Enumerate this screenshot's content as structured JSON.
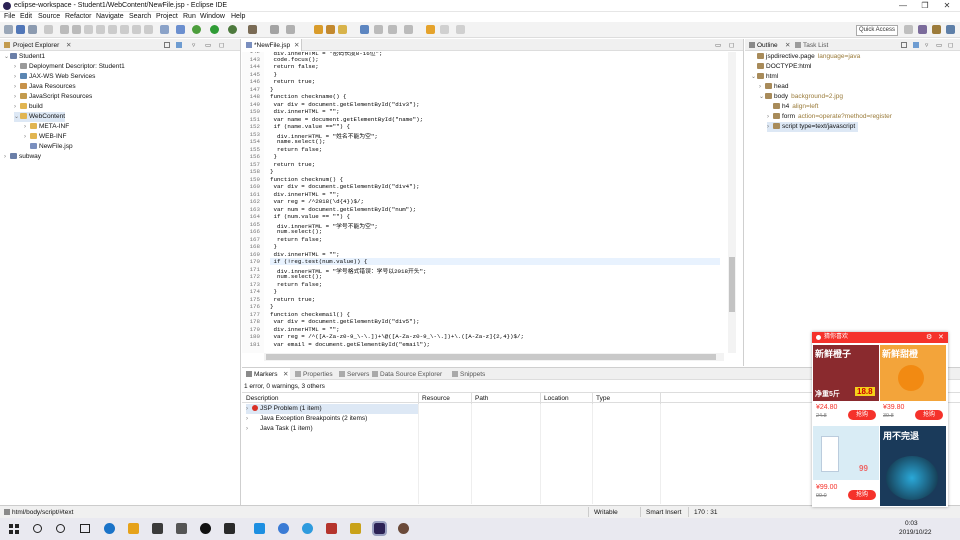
{
  "window": {
    "title": "eclipse-workspace - Student1/WebContent/NewFile.jsp - Eclipse IDE",
    "minimize": "—",
    "maximize": "❐",
    "close": "✕"
  },
  "menu": [
    "File",
    "Edit",
    "Source",
    "Refactor",
    "Navigate",
    "Search",
    "Project",
    "Run",
    "Window",
    "Help"
  ],
  "quick_access": "Quick Access",
  "project_explorer": {
    "tab": "Project Explorer",
    "items": [
      {
        "label": "Student1",
        "indent": 0,
        "arrow": "v",
        "icon": "project"
      },
      {
        "label": "Deployment Descriptor: Student1",
        "indent": 1,
        "arrow": ">",
        "icon": "dd"
      },
      {
        "label": "JAX-WS Web Services",
        "indent": 1,
        "arrow": ">",
        "icon": "ws"
      },
      {
        "label": "Java Resources",
        "indent": 1,
        "arrow": ">",
        "icon": "jr"
      },
      {
        "label": "JavaScript Resources",
        "indent": 1,
        "arrow": ">",
        "icon": "js"
      },
      {
        "label": "build",
        "indent": 1,
        "arrow": ">",
        "icon": "folder"
      },
      {
        "label": "WebContent",
        "indent": 1,
        "arrow": "v",
        "icon": "folder",
        "selected": true
      },
      {
        "label": "META-INF",
        "indent": 2,
        "arrow": ">",
        "icon": "folder"
      },
      {
        "label": "WEB-INF",
        "indent": 2,
        "arrow": ">",
        "icon": "folder"
      },
      {
        "label": "NewFile.jsp",
        "indent": 2,
        "arrow": "",
        "icon": "jsp"
      },
      {
        "label": "subway",
        "indent": 0,
        "arrow": ">",
        "icon": "project"
      }
    ]
  },
  "editor": {
    "tab": "*NewFile.jsp",
    "lines": [
      {
        "n": "142",
        "t": " div.innerHTML = \"密码长度8-16位\";"
      },
      {
        "n": "143",
        "t": " code.focus();"
      },
      {
        "n": "144",
        "t": " return false;"
      },
      {
        "n": "145",
        "t": " }"
      },
      {
        "n": "146",
        "t": " return true;"
      },
      {
        "n": "147",
        "t": "}"
      },
      {
        "n": "148",
        "t": "function checkname() {"
      },
      {
        "n": "149",
        "t": " var div = document.getElementById(\"div3\");"
      },
      {
        "n": "150",
        "t": " div.innerHTML = \"\";"
      },
      {
        "n": "151",
        "t": " var name = document.getElementById(\"name\");"
      },
      {
        "n": "152",
        "t": " if (name.value ==\"\") {"
      },
      {
        "n": "153",
        "t": "  div.innerHTML = \"姓名不能为空\";"
      },
      {
        "n": "154",
        "t": "  name.select();"
      },
      {
        "n": "155",
        "t": "  return false;"
      },
      {
        "n": "156",
        "t": " }"
      },
      {
        "n": "157",
        "t": " return true;"
      },
      {
        "n": "158",
        "t": "}"
      },
      {
        "n": "159",
        "t": "function checknum() {"
      },
      {
        "n": "160",
        "t": " var div = document.getElementById(\"div4\");"
      },
      {
        "n": "161",
        "t": " div.innerHTML = \"\";"
      },
      {
        "n": "162",
        "t": " var reg = /^2018(\\d{4})$/;"
      },
      {
        "n": "163",
        "t": " var num = document.getElementById(\"num\");"
      },
      {
        "n": "164",
        "t": " if (num.value == \"\") {"
      },
      {
        "n": "165",
        "t": "  div.innerHTML = \"学号不能为空\";"
      },
      {
        "n": "166",
        "t": "  num.select();"
      },
      {
        "n": "167",
        "t": "  return false;"
      },
      {
        "n": "168",
        "t": " }"
      },
      {
        "n": "169",
        "t": " div.innerHTML = \"\";"
      },
      {
        "n": "170",
        "t": " if (!reg.test(num.value)) {"
      },
      {
        "n": "171",
        "t": "  div.innerHTML = \"学号格式错误：学号以2018开头\";"
      },
      {
        "n": "172",
        "t": "  num.select();"
      },
      {
        "n": "173",
        "t": "  return false;"
      },
      {
        "n": "174",
        "t": " }"
      },
      {
        "n": "175",
        "t": " return true;"
      },
      {
        "n": "176",
        "t": "}"
      },
      {
        "n": "177",
        "t": "function checkemail() {"
      },
      {
        "n": "178",
        "t": " var div = document.getElementById(\"div5\");"
      },
      {
        "n": "179",
        "t": " div.innerHTML = \"\";"
      },
      {
        "n": "180",
        "t": " var reg = /^([A-Za-z0-9_\\-\\.])+\\@([A-Za-z0-9_\\-\\.])+\\.([A-Za-z]{2,4})$/;"
      },
      {
        "n": "181",
        "t": " var email = document.getElementById(\"email\");"
      }
    ]
  },
  "outline": {
    "tab": "Outline",
    "tab2": "Task List",
    "items": [
      {
        "label": "jspdirective.page",
        "extra": "language=java",
        "indent": 0
      },
      {
        "label": "DOCTYPE:html",
        "extra": "",
        "indent": 0
      },
      {
        "label": "html",
        "extra": "",
        "indent": 0,
        "arrow": "v"
      },
      {
        "label": "head",
        "extra": "",
        "indent": 1,
        "arrow": ">"
      },
      {
        "label": "body",
        "extra": "background=2.jpg",
        "indent": 1,
        "arrow": "v"
      },
      {
        "label": "h4",
        "extra": "align=left",
        "indent": 2,
        "arrow": ""
      },
      {
        "label": "form",
        "extra": "action=operate?method=register",
        "indent": 2,
        "arrow": ">"
      },
      {
        "label": "script type=text/javascript",
        "extra": "",
        "indent": 2,
        "arrow": ">",
        "selected": true
      }
    ]
  },
  "bottom": {
    "tabs": [
      "Markers",
      "Properties",
      "Servers",
      "Data Source Explorer",
      "Snippets"
    ],
    "summary": "1 error, 0 warnings, 3 others",
    "columns": [
      "Description",
      "Resource",
      "Path",
      "Location",
      "Type"
    ],
    "rows": [
      {
        "label": "JSP Problem (1 item)",
        "error": true
      },
      {
        "label": "Java Exception Breakpoints (2 items)",
        "error": false
      },
      {
        "label": "Java Task (1 item)",
        "error": false
      }
    ]
  },
  "status": {
    "path": "html/body/script/#text",
    "mode": "Writable",
    "insert": "Smart Insert",
    "pos": "170 : 31"
  },
  "taskbar": {
    "time": "0:03",
    "date": "2019/10/22"
  },
  "ad": {
    "title": "猜你喜欢",
    "items": [
      {
        "banner": "新鲜橙子",
        "price_tag": "净重5斤",
        "price_tag2": "18.8",
        "price": "¥24.80",
        "orig": "24.8",
        "btn": "抢购",
        "color": "#c4283a"
      },
      {
        "banner": "新鲜甜橙",
        "price_tag": "",
        "price_tag2": "",
        "price": "¥39.80",
        "orig": "39.8",
        "btn": "抢购",
        "color": "#f08a1c"
      },
      {
        "banner": "",
        "price_tag": "",
        "price_tag2": "99",
        "price": "¥99.00",
        "orig": "99.0",
        "btn": "抢购",
        "color": "#d9ecf5"
      },
      {
        "banner": "用不完退",
        "price_tag": "",
        "price_tag2": "",
        "price": "",
        "orig": "",
        "btn": "",
        "color": "#1a3a5a"
      }
    ]
  }
}
